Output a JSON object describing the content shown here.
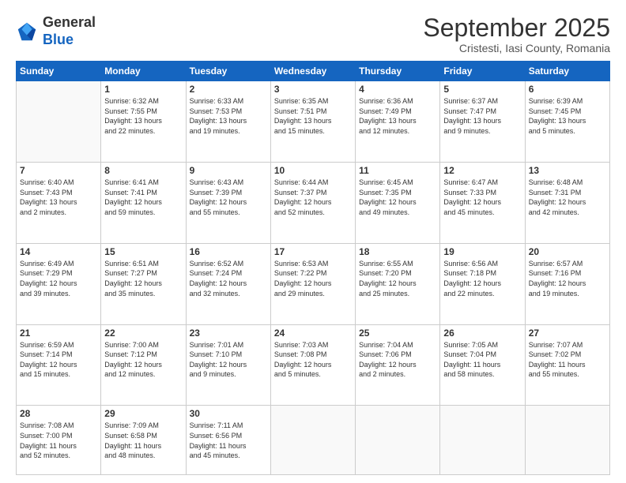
{
  "logo": {
    "general": "General",
    "blue": "Blue"
  },
  "header": {
    "month": "September 2025",
    "location": "Cristesti, Iasi County, Romania"
  },
  "weekdays": [
    "Sunday",
    "Monday",
    "Tuesday",
    "Wednesday",
    "Thursday",
    "Friday",
    "Saturday"
  ],
  "weeks": [
    [
      {
        "day": "",
        "info": ""
      },
      {
        "day": "1",
        "info": "Sunrise: 6:32 AM\nSunset: 7:55 PM\nDaylight: 13 hours\nand 22 minutes."
      },
      {
        "day": "2",
        "info": "Sunrise: 6:33 AM\nSunset: 7:53 PM\nDaylight: 13 hours\nand 19 minutes."
      },
      {
        "day": "3",
        "info": "Sunrise: 6:35 AM\nSunset: 7:51 PM\nDaylight: 13 hours\nand 15 minutes."
      },
      {
        "day": "4",
        "info": "Sunrise: 6:36 AM\nSunset: 7:49 PM\nDaylight: 13 hours\nand 12 minutes."
      },
      {
        "day": "5",
        "info": "Sunrise: 6:37 AM\nSunset: 7:47 PM\nDaylight: 13 hours\nand 9 minutes."
      },
      {
        "day": "6",
        "info": "Sunrise: 6:39 AM\nSunset: 7:45 PM\nDaylight: 13 hours\nand 5 minutes."
      }
    ],
    [
      {
        "day": "7",
        "info": "Sunrise: 6:40 AM\nSunset: 7:43 PM\nDaylight: 13 hours\nand 2 minutes."
      },
      {
        "day": "8",
        "info": "Sunrise: 6:41 AM\nSunset: 7:41 PM\nDaylight: 12 hours\nand 59 minutes."
      },
      {
        "day": "9",
        "info": "Sunrise: 6:43 AM\nSunset: 7:39 PM\nDaylight: 12 hours\nand 55 minutes."
      },
      {
        "day": "10",
        "info": "Sunrise: 6:44 AM\nSunset: 7:37 PM\nDaylight: 12 hours\nand 52 minutes."
      },
      {
        "day": "11",
        "info": "Sunrise: 6:45 AM\nSunset: 7:35 PM\nDaylight: 12 hours\nand 49 minutes."
      },
      {
        "day": "12",
        "info": "Sunrise: 6:47 AM\nSunset: 7:33 PM\nDaylight: 12 hours\nand 45 minutes."
      },
      {
        "day": "13",
        "info": "Sunrise: 6:48 AM\nSunset: 7:31 PM\nDaylight: 12 hours\nand 42 minutes."
      }
    ],
    [
      {
        "day": "14",
        "info": "Sunrise: 6:49 AM\nSunset: 7:29 PM\nDaylight: 12 hours\nand 39 minutes."
      },
      {
        "day": "15",
        "info": "Sunrise: 6:51 AM\nSunset: 7:27 PM\nDaylight: 12 hours\nand 35 minutes."
      },
      {
        "day": "16",
        "info": "Sunrise: 6:52 AM\nSunset: 7:24 PM\nDaylight: 12 hours\nand 32 minutes."
      },
      {
        "day": "17",
        "info": "Sunrise: 6:53 AM\nSunset: 7:22 PM\nDaylight: 12 hours\nand 29 minutes."
      },
      {
        "day": "18",
        "info": "Sunrise: 6:55 AM\nSunset: 7:20 PM\nDaylight: 12 hours\nand 25 minutes."
      },
      {
        "day": "19",
        "info": "Sunrise: 6:56 AM\nSunset: 7:18 PM\nDaylight: 12 hours\nand 22 minutes."
      },
      {
        "day": "20",
        "info": "Sunrise: 6:57 AM\nSunset: 7:16 PM\nDaylight: 12 hours\nand 19 minutes."
      }
    ],
    [
      {
        "day": "21",
        "info": "Sunrise: 6:59 AM\nSunset: 7:14 PM\nDaylight: 12 hours\nand 15 minutes."
      },
      {
        "day": "22",
        "info": "Sunrise: 7:00 AM\nSunset: 7:12 PM\nDaylight: 12 hours\nand 12 minutes."
      },
      {
        "day": "23",
        "info": "Sunrise: 7:01 AM\nSunset: 7:10 PM\nDaylight: 12 hours\nand 9 minutes."
      },
      {
        "day": "24",
        "info": "Sunrise: 7:03 AM\nSunset: 7:08 PM\nDaylight: 12 hours\nand 5 minutes."
      },
      {
        "day": "25",
        "info": "Sunrise: 7:04 AM\nSunset: 7:06 PM\nDaylight: 12 hours\nand 2 minutes."
      },
      {
        "day": "26",
        "info": "Sunrise: 7:05 AM\nSunset: 7:04 PM\nDaylight: 11 hours\nand 58 minutes."
      },
      {
        "day": "27",
        "info": "Sunrise: 7:07 AM\nSunset: 7:02 PM\nDaylight: 11 hours\nand 55 minutes."
      }
    ],
    [
      {
        "day": "28",
        "info": "Sunrise: 7:08 AM\nSunset: 7:00 PM\nDaylight: 11 hours\nand 52 minutes."
      },
      {
        "day": "29",
        "info": "Sunrise: 7:09 AM\nSunset: 6:58 PM\nDaylight: 11 hours\nand 48 minutes."
      },
      {
        "day": "30",
        "info": "Sunrise: 7:11 AM\nSunset: 6:56 PM\nDaylight: 11 hours\nand 45 minutes."
      },
      {
        "day": "",
        "info": ""
      },
      {
        "day": "",
        "info": ""
      },
      {
        "day": "",
        "info": ""
      },
      {
        "day": "",
        "info": ""
      }
    ]
  ]
}
